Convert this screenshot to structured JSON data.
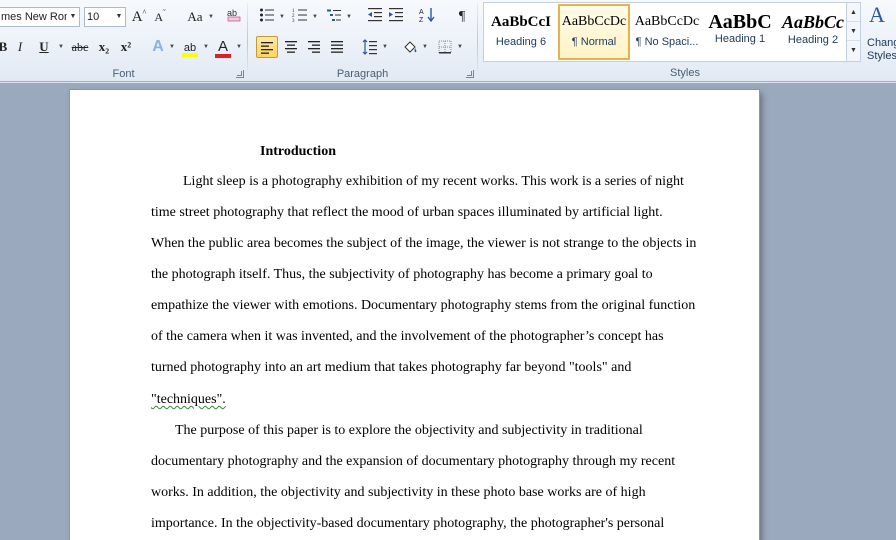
{
  "font": {
    "family_value": "mes New Rom",
    "size_value": "10",
    "grow_label": "A",
    "shrink_label": "A",
    "change_case_label": "Aa",
    "clear_format_label": "ab",
    "bold_label": "B",
    "italic_label": "I",
    "underline_label": "U",
    "strike_label": "abc",
    "subscript_label": "x₂",
    "superscript_label": "x²",
    "text_effects_label": "A",
    "highlight_label": "ab",
    "font_color_label": "A",
    "group_label": "Font"
  },
  "paragraph": {
    "group_label": "Paragraph",
    "pilcrow_label": "¶"
  },
  "styles": {
    "group_label": "Styles",
    "items": [
      {
        "sample": "AaBbCcI",
        "name": "Heading 6"
      },
      {
        "sample": "AaBbCcDc",
        "name": "¶ Normal"
      },
      {
        "sample": "AaBbCcDc",
        "name": "¶ No Spaci..."
      },
      {
        "sample": "AaBbC",
        "name": "Heading 1"
      },
      {
        "sample": "AaBbCc",
        "name": "Heading 2"
      }
    ],
    "change_styles_label_1": "Change",
    "change_styles_label_2": "Styles"
  },
  "document": {
    "title": "Introduction",
    "lines": [
      "Light sleep is a photography exhibition of my recent works. This work is a series of night",
      "time street photography that reflect the mood of urban spaces illuminated by artificial light.",
      "When the public area becomes the subject of the image, the viewer is not strange to the objects in",
      "the photograph itself. Thus, the subjectivity of photography has become a primary goal to",
      "empathize the viewer with emotions. Documentary photography stems from the original function",
      "of the camera when it was invented, and the involvement of the photographer’s concept has",
      "turned photography into an art medium that takes photography far beyond \"tools\" and",
      "\"techniques\".",
      "The purpose of this paper is to explore the objectivity and subjectivity in traditional",
      "documentary photography and the expansion of documentary photography through my recent",
      "works. In addition, the objectivity and subjectivity in these photo base works are of high",
      "importance. In the objectivity-based documentary photography, the photographer's personal"
    ]
  },
  "colors": {
    "highlight": "#ffff00",
    "font_color": "#e02020",
    "selected_style_border": "#e7b24d",
    "spell_squiggle": "#2e8b2e"
  }
}
